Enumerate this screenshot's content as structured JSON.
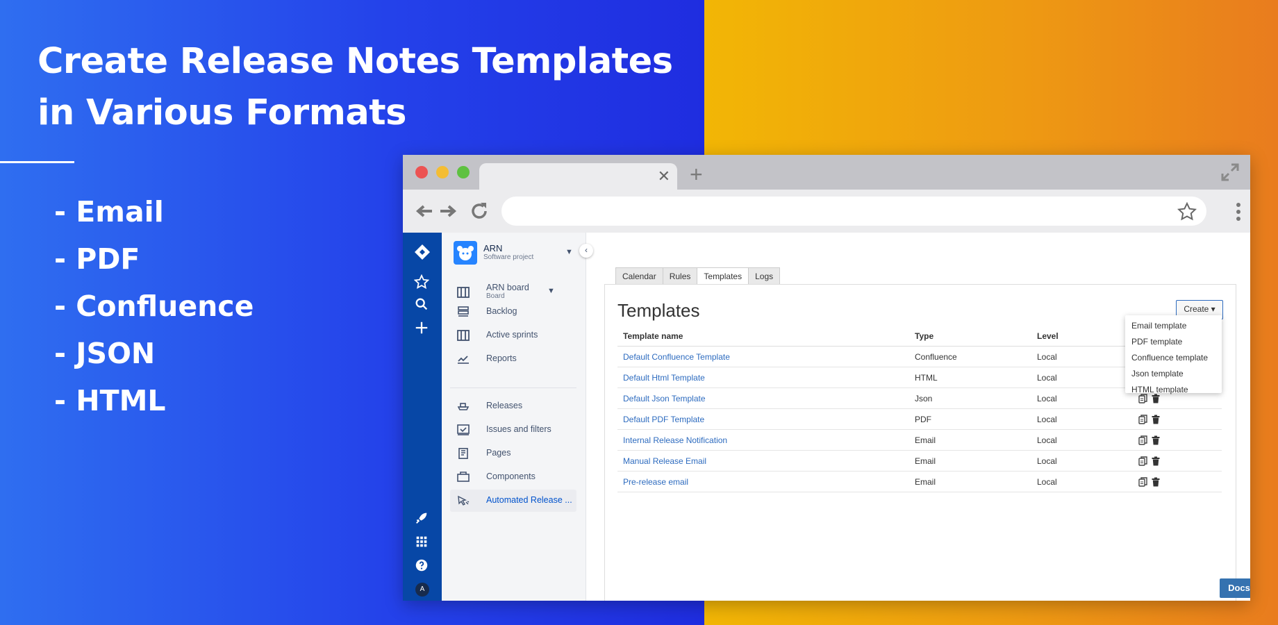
{
  "banner": {
    "headline_line1": "Create Release Notes Templates",
    "headline_line2": "in Various Formats",
    "formats": [
      "- Email",
      "- PDF",
      "- Confluence",
      "- JSON",
      "- HTML"
    ]
  },
  "colors": {
    "left_gradient_start": "#2f6ef0",
    "left_gradient_end": "#1f2de0",
    "right_gradient_start": "#f2b605",
    "right_gradient_end": "#e97c1e",
    "jira_nav": "#0747a6",
    "link_blue": "#2d6bbf",
    "docs_button": "#3572b0"
  },
  "browser": {
    "tab_close_icon": "close-icon",
    "new_tab_icon": "plus-icon",
    "address_value": ""
  },
  "sidebar": {
    "project_name": "ARN",
    "project_type": "Software project",
    "board_name": "ARN board",
    "board_type": "Board",
    "items": [
      {
        "label": "Backlog",
        "icon": "backlog-icon"
      },
      {
        "label": "Active sprints",
        "icon": "sprint-board-icon"
      },
      {
        "label": "Reports",
        "icon": "reports-chart-icon"
      },
      {
        "label": "Releases",
        "icon": "ship-icon"
      },
      {
        "label": "Issues and filters",
        "icon": "issues-icon"
      },
      {
        "label": "Pages",
        "icon": "page-icon"
      },
      {
        "label": "Components",
        "icon": "component-icon"
      },
      {
        "label": "Automated Release ...",
        "icon": "automation-icon",
        "active": true
      }
    ]
  },
  "content": {
    "tabs": [
      "Calendar",
      "Rules",
      "Templates",
      "Logs"
    ],
    "active_tab": "Templates",
    "title": "Templates",
    "create_button": "Create ▾",
    "create_menu": [
      "Email template",
      "PDF template",
      "Confluence template",
      "Json template",
      "HTML template"
    ],
    "columns": [
      "Template name",
      "Type",
      "Level"
    ],
    "rows": [
      {
        "name": "Default Confluence Template",
        "type": "Confluence",
        "level": "Local"
      },
      {
        "name": "Default Html Template",
        "type": "HTML",
        "level": "Local"
      },
      {
        "name": "Default Json Template",
        "type": "Json",
        "level": "Local"
      },
      {
        "name": "Default PDF Template",
        "type": "PDF",
        "level": "Local"
      },
      {
        "name": "Internal Release Notification",
        "type": "Email",
        "level": "Local"
      },
      {
        "name": "Manual Release Email",
        "type": "Email",
        "level": "Local"
      },
      {
        "name": "Pre-release email",
        "type": "Email",
        "level": "Local"
      }
    ],
    "docs_button": "Docs"
  },
  "global_nav": {
    "avatar_initial": "A"
  }
}
